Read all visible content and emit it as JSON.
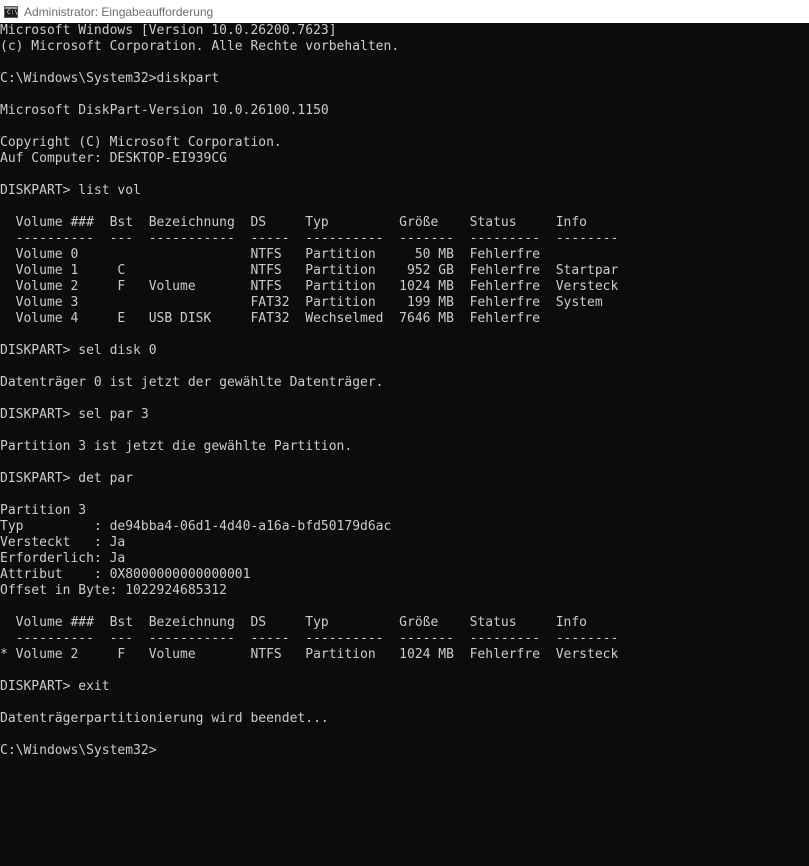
{
  "window": {
    "title": "Administrator: Eingabeaufforderung",
    "icon": "cmd-console-icon",
    "icon_glyph": "C:\\"
  },
  "colors": {
    "background": "#0c0c0c",
    "foreground": "#cccccc",
    "titlebar": "#ffffff",
    "title_text": "#6e6e6e"
  },
  "console": {
    "lines": [
      "Microsoft Windows [Version 10.0.26200.7623]",
      "(c) Microsoft Corporation. Alle Rechte vorbehalten.",
      "",
      "C:\\Windows\\System32>diskpart",
      "",
      "Microsoft DiskPart-Version 10.0.26100.1150",
      "",
      "Copyright (C) Microsoft Corporation.",
      "Auf Computer: DESKTOP-EI939CG",
      "",
      "DISKPART> list vol",
      "",
      "  Volume ###  Bst  Bezeichnung  DS     Typ         Größe    Status     Info",
      "  ----------  ---  -----------  -----  ----------  -------  ---------  --------",
      "  Volume 0                      NTFS   Partition     50 MB  Fehlerfre",
      "  Volume 1     C                NTFS   Partition    952 GB  Fehlerfre  Startpar",
      "  Volume 2     F   Volume       NTFS   Partition   1024 MB  Fehlerfre  Versteck",
      "  Volume 3                      FAT32  Partition    199 MB  Fehlerfre  System",
      "  Volume 4     E   USB DISK     FAT32  Wechselmed  7646 MB  Fehlerfre",
      "",
      "DISKPART> sel disk 0",
      "",
      "Datenträger 0 ist jetzt der gewählte Datenträger.",
      "",
      "DISKPART> sel par 3",
      "",
      "Partition 3 ist jetzt die gewählte Partition.",
      "",
      "DISKPART> det par",
      "",
      "Partition 3",
      "Typ         : de94bba4-06d1-4d40-a16a-bfd50179d6ac",
      "Versteckt   : Ja",
      "Erforderlich: Ja",
      "Attribut    : 0X8000000000000001",
      "Offset in Byte: 1022924685312",
      "",
      "  Volume ###  Bst  Bezeichnung  DS     Typ         Größe    Status     Info",
      "  ----------  ---  -----------  -----  ----------  -------  ---------  --------",
      "* Volume 2     F   Volume       NTFS   Partition   1024 MB  Fehlerfre  Versteck",
      "",
      "DISKPART> exit",
      "",
      "Datenträgerpartitionierung wird beendet...",
      "",
      "C:\\Windows\\System32>"
    ]
  }
}
